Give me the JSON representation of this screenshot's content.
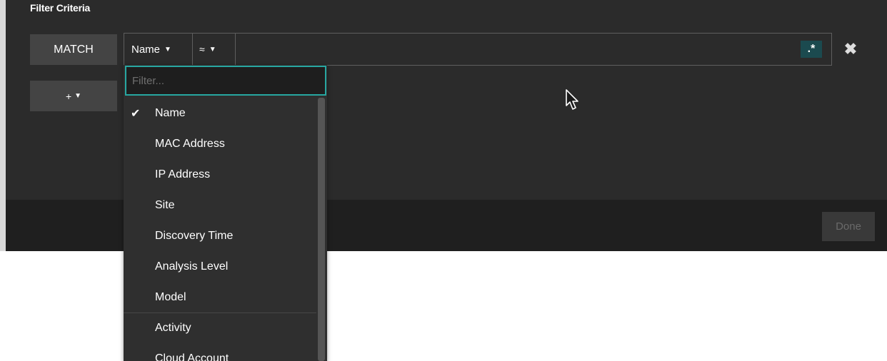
{
  "panel": {
    "title": "Filter Criteria"
  },
  "criteria": {
    "match_label": "MATCH",
    "field_value": "Name",
    "operator_value": "≈",
    "value_text": "",
    "regex_label": ".*",
    "remove_icon": "close-icon"
  },
  "add_button": {
    "label": "+"
  },
  "footer": {
    "done_label": "Done"
  },
  "dropdown": {
    "filter_placeholder": "Filter...",
    "selected": "Name",
    "items": [
      {
        "label": "Name"
      },
      {
        "label": "MAC Address"
      },
      {
        "label": "IP Address"
      },
      {
        "label": "Site"
      },
      {
        "label": "Discovery Time"
      },
      {
        "label": "Analysis Level"
      },
      {
        "label": "Model"
      },
      {
        "label": "Activity"
      },
      {
        "label": "Cloud Account"
      }
    ]
  },
  "colors": {
    "accent": "#27a7a1",
    "regex_bg": "#1b4a4f",
    "panel_bg": "#2b2b2b"
  }
}
